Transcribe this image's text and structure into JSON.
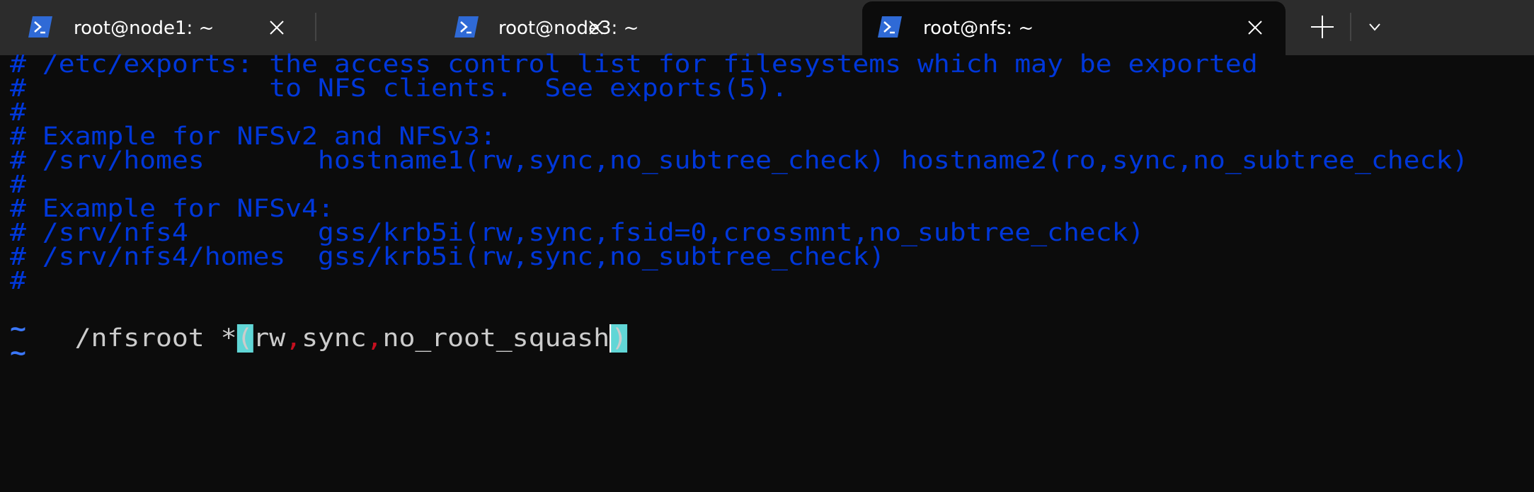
{
  "tabs": [
    {
      "title": "root@node1: ~",
      "icon": "powershell-icon",
      "active": false
    },
    {
      "title": "root@node3: ~",
      "icon": "powershell-icon",
      "active": false
    },
    {
      "title": "root@nfs: ~",
      "icon": "powershell-icon",
      "active": true
    }
  ],
  "tabbar": {
    "new_tab": "+",
    "dropdown": "v"
  },
  "colors": {
    "comment": "#0037da",
    "text": "#cccccc",
    "tilde": "#3b78ff",
    "match_highlight": "#61d6d6",
    "error_comma": "#c50f1f",
    "background": "#0c0c0c",
    "tabbar": "#2c2c2c"
  },
  "editor": {
    "comment_lines": [
      "# /etc/exports: the access control list for filesystems which may be exported",
      "#               to NFS clients.  See exports(5).",
      "#",
      "# Example for NFSv2 and NFSv3:",
      "# /srv/homes       hostname1(rw,sync,no_subtree_check) hostname2(ro,sync,no_subtree_check)",
      "#",
      "# Example for NFSv4:",
      "# /srv/nfs4        gss/krb5i(rw,sync,fsid=0,crossmnt,no_subtree_check)",
      "# /srv/nfs4/homes  gss/krb5i(rw,sync,no_subtree_check)",
      "#"
    ],
    "export_line": {
      "path_and_host": "/nfsroot *",
      "open_paren": "(",
      "opt1": "rw",
      "comma1": ",",
      "opt2": "sync",
      "comma2": ",",
      "opt3": "no_root_squash",
      "close_paren": ")"
    },
    "empty_markers": [
      "~",
      "~"
    ]
  }
}
